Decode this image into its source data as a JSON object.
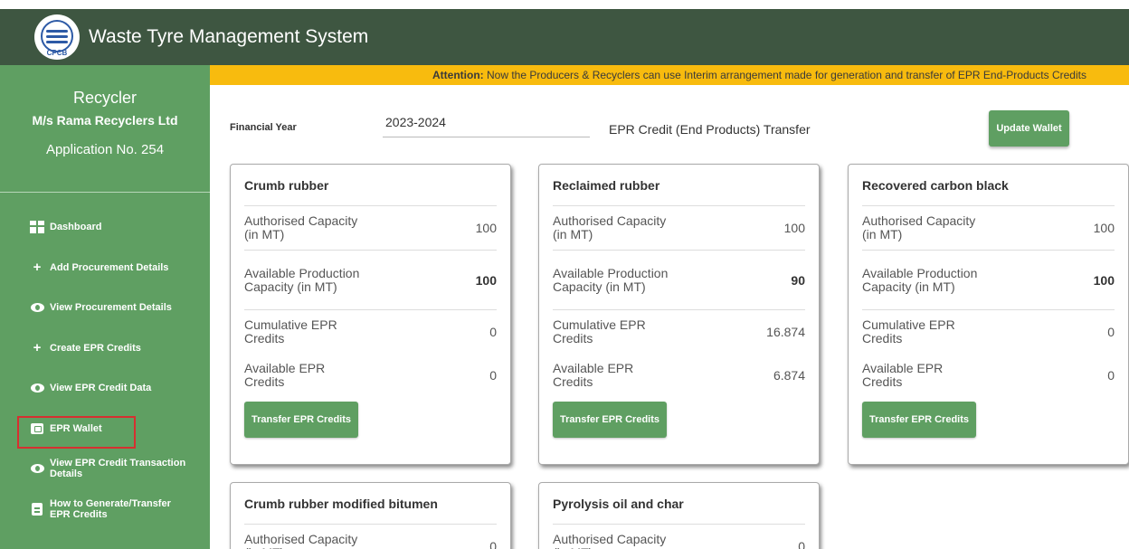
{
  "app": {
    "title": "Waste Tyre Management System",
    "logo_text": "CPCB"
  },
  "sidebar": {
    "role": "Recycler",
    "org": "M/s Rama Recyclers Ltd",
    "application": "Application No. 254",
    "items": [
      {
        "label": "Dashboard",
        "icon": "dashboard-icon"
      },
      {
        "label": "Add Procurement Details",
        "icon": "plus-icon"
      },
      {
        "label": "View Procurement Details",
        "icon": "eye-icon"
      },
      {
        "label": "Create EPR Credits",
        "icon": "plus-icon"
      },
      {
        "label": "View EPR Credit Data",
        "icon": "eye-icon"
      },
      {
        "label": "EPR Wallet",
        "icon": "wallet-icon",
        "active": true
      },
      {
        "label": "View EPR Credit Transaction Details",
        "icon": "eye-icon"
      },
      {
        "label": "How to Generate/Transfer EPR Credits",
        "icon": "clipboard-icon"
      }
    ]
  },
  "banner": {
    "strong": "Attention:",
    "text": " Now the Producers & Recyclers can use Interim arrangement made for generation and transfer of EPR End-Products Credits"
  },
  "form": {
    "fy_label": "Financial Year",
    "fy_value": "2023-2024",
    "transfer_title": "EPR Credit (End Products) Transfer",
    "update_button": "Update Wallet"
  },
  "labels": {
    "authorised": "Authorised Capacity (in MT)",
    "available_production": "Available Production Capacity (in MT)",
    "cumulative": "Cumulative EPR Credits",
    "available_epr": "Available EPR Credits",
    "transfer_button": "Transfer EPR Credits"
  },
  "cards": [
    {
      "title": "Crumb rubber",
      "authorised": "100",
      "available_production": "100",
      "cumulative": "0",
      "available_epr": "0"
    },
    {
      "title": "Reclaimed rubber",
      "authorised": "100",
      "available_production": "90",
      "cumulative": "16.874",
      "available_epr": "6.874"
    },
    {
      "title": "Recovered carbon black",
      "authorised": "100",
      "available_production": "100",
      "cumulative": "0",
      "available_epr": "0"
    },
    {
      "title": "Crumb rubber modified bitumen",
      "authorised": "0"
    },
    {
      "title": "Pyrolysis oil and char",
      "authorised": "0"
    }
  ],
  "colors": {
    "header": "#3e5641",
    "sidebar": "#5f9f62",
    "banner": "#f8bb0e",
    "active_outline": "#d63030"
  }
}
